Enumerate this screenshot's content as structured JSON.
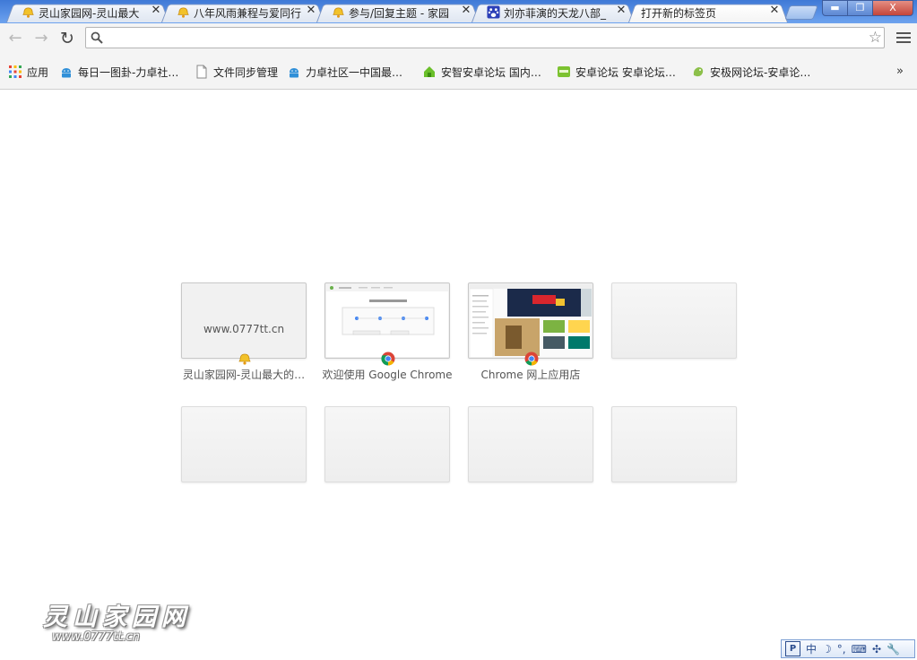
{
  "tabs": [
    {
      "title": "灵山家园网-灵山最大",
      "favicon": "bell-yellow-icon",
      "active": false
    },
    {
      "title": "八年风雨兼程与爱同行",
      "favicon": "bell-yellow-icon",
      "active": false
    },
    {
      "title": "参与/回复主题 - 家园",
      "favicon": "bell-yellow-icon",
      "active": false
    },
    {
      "title": "刘亦菲演的天龙八部_",
      "favicon": "baidu-paw-icon",
      "active": false
    },
    {
      "title": "打开新的标签页",
      "favicon": "",
      "active": true
    }
  ],
  "window_buttons": {
    "minimize": "▬",
    "restore": "❐",
    "close": "X"
  },
  "toolbar": {
    "back_glyph": "←",
    "forward_glyph": "→",
    "reload_glyph": "↻",
    "omnibox_value": "",
    "omnibox_placeholder": "",
    "star_glyph": "☆"
  },
  "bookmarks": {
    "items": [
      {
        "label": "应用",
        "icon": "apps-grid-icon"
      },
      {
        "label": "每日一图卦-力卓社…",
        "icon": "android-icon"
      },
      {
        "label": "文件同步管理",
        "icon": "page-icon"
      },
      {
        "label": "力卓社区一中国最…",
        "icon": "android-icon"
      },
      {
        "label": "安智安卓论坛  国内…",
        "icon": "anzhi-icon"
      },
      {
        "label": "安卓论坛  安卓论坛…",
        "icon": "android-forum-icon"
      },
      {
        "label": "安极网论坛-安卓论…",
        "icon": "anji-icon"
      }
    ],
    "more_glyph": "»"
  },
  "most_visited": [
    {
      "title": "灵山家园网-灵山最大的…",
      "thumb_text": "www.0777tt.cn",
      "favicon": "bell-yellow-icon"
    },
    {
      "title": "欢迎使用 Google Chrome",
      "thumb_text": "",
      "favicon": "chrome-icon"
    },
    {
      "title": "Chrome 网上应用店",
      "thumb_text": "",
      "favicon": "chrome-icon"
    },
    {
      "title": "",
      "thumb_text": "",
      "favicon": ""
    },
    {
      "title": "",
      "thumb_text": "",
      "favicon": ""
    },
    {
      "title": "",
      "thumb_text": "",
      "favicon": ""
    },
    {
      "title": "",
      "thumb_text": "",
      "favicon": ""
    },
    {
      "title": "",
      "thumb_text": "",
      "favicon": ""
    }
  ],
  "watermark": {
    "title": "灵山家园网",
    "url": "www.0777tt.cn"
  },
  "ime_bar": {
    "logo": "P",
    "mode": "中",
    "items": [
      "☽",
      "°,",
      "⌨",
      "✣",
      "🔧"
    ]
  },
  "colors": {
    "tab_strip": "#5a92e6",
    "toolbar": "#f4f4f4",
    "window_close": "#c4453a"
  }
}
